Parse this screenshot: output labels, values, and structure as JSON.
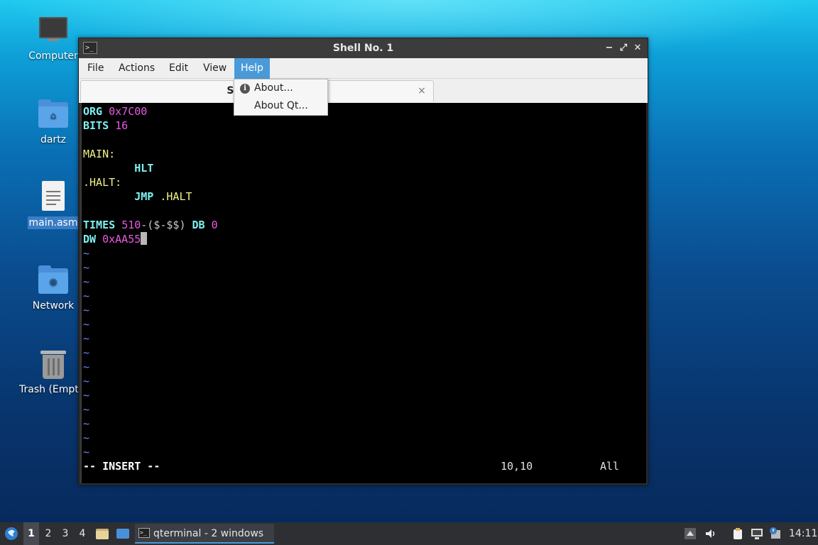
{
  "desktop": {
    "icons": [
      {
        "label": "Computer",
        "icon": "computer-icon"
      },
      {
        "label": "dartz",
        "icon": "home-folder-icon"
      },
      {
        "label": "main.asm",
        "icon": "text-file-icon",
        "selected": true
      },
      {
        "label": "Network",
        "icon": "network-folder-icon"
      },
      {
        "label": "Trash (Empty)",
        "icon": "trash-icon"
      }
    ]
  },
  "window": {
    "title": "Shell No. 1",
    "controls": {
      "minimize": "−",
      "maximize": "⤢",
      "close": "✕"
    },
    "menu": [
      "File",
      "Actions",
      "Edit",
      "View",
      "Help"
    ],
    "active_menu": "Help",
    "tab": {
      "label": "Shell No. 1",
      "close": "×"
    },
    "help_menu": {
      "items": [
        {
          "label": "About...",
          "icon": "info-icon"
        },
        {
          "label": "About Qt..."
        }
      ]
    }
  },
  "terminal": {
    "lines": {
      "l1a": "ORG",
      "l1b": "0x7C00",
      "l2a": "BITS",
      "l2b": "16",
      "l4": "MAIN:",
      "l5": "HLT",
      "l6": ".HALT:",
      "l7a": "JMP",
      "l7b": ".HALT",
      "l9a": "TIMES",
      "l9b": "510",
      "l9c": "-($-$$)",
      "l9d": "DB",
      "l9e": "0",
      "l10a": "DW",
      "l10b": "0xAA55"
    },
    "tilde": "~",
    "status": {
      "mode": "-- INSERT --",
      "position": "10,10",
      "scroll": "All"
    }
  },
  "taskbar": {
    "workspaces": [
      "1",
      "2",
      "3",
      "4"
    ],
    "active_workspace": "1",
    "task_label": "qterminal - 2 windows",
    "clock": "14:11"
  },
  "colors": {
    "accent": "#4a9ad8",
    "terminal_bg": "#000000",
    "keyword": "#7ff0f2",
    "number": "#e85ae3",
    "label": "#f2f28a",
    "tilde": "#6a86ff"
  }
}
